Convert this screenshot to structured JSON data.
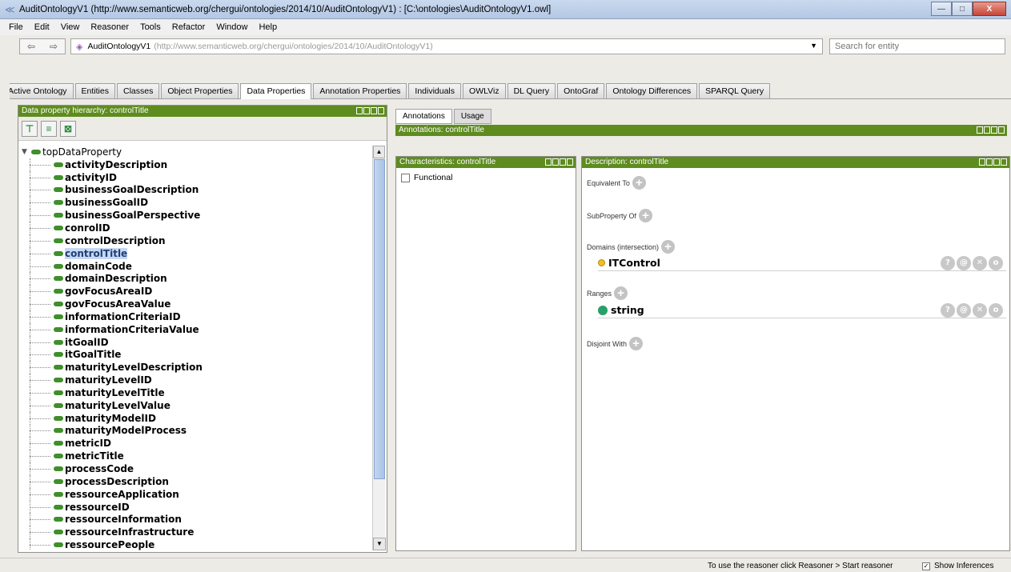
{
  "window": {
    "title": "AuditOntologyV1 (http://www.semanticweb.org/chergui/ontologies/2014/10/AuditOntologyV1)  : [C:\\ontologies\\AuditOntologyV1.owl]",
    "minimize": "—",
    "maximize": "□",
    "close": "X"
  },
  "menu": [
    "File",
    "Edit",
    "View",
    "Reasoner",
    "Tools",
    "Refactor",
    "Window",
    "Help"
  ],
  "address": {
    "name": "AuditOntologyV1",
    "uri": "(http://www.semanticweb.org/chergui/ontologies/2014/10/AuditOntologyV1)",
    "search_placeholder": "Search for entity"
  },
  "tabs": [
    {
      "label": "Active Ontology",
      "active": false
    },
    {
      "label": "Entities",
      "active": false
    },
    {
      "label": "Classes",
      "active": false
    },
    {
      "label": "Object Properties",
      "active": false
    },
    {
      "label": "Data Properties",
      "active": true
    },
    {
      "label": "Annotation Properties",
      "active": false
    },
    {
      "label": "Individuals",
      "active": false
    },
    {
      "label": "OWLViz",
      "active": false
    },
    {
      "label": "DL Query",
      "active": false
    },
    {
      "label": "OntoGraf",
      "active": false
    },
    {
      "label": "Ontology Differences",
      "active": false
    },
    {
      "label": "SPARQL Query",
      "active": false
    }
  ],
  "hierarchy": {
    "header": "Data property hierarchy: controlTitle",
    "root": "topDataProperty",
    "selected": "controlTitle",
    "items": [
      "activityDescription",
      "activityID",
      "businessGoalDescription",
      "businessGoalID",
      "businessGoalPerspective",
      "conrolID",
      "controlDescription",
      "controlTitle",
      "domainCode",
      "domainDescription",
      "govFocusAreaID",
      "govFocusAreaValue",
      "informationCriteriaID",
      "informationCriteriaValue",
      "itGoalID",
      "itGoalTitle",
      "maturityLevelDescription",
      "maturityLevelID",
      "maturityLevelTitle",
      "maturityLevelValue",
      "maturityModelID",
      "maturityModelProcess",
      "metricID",
      "metricTitle",
      "processCode",
      "processDescription",
      "ressourceApplication",
      "ressourceID",
      "ressourceInformation",
      "ressourceInfrastructure",
      "ressourcePeople"
    ]
  },
  "subtabs": {
    "annotations": "Annotations",
    "usage": "Usage"
  },
  "annotations_header": "Annotations: controlTitle",
  "characteristics": {
    "header": "Characteristics: controlTitle",
    "functional": "Functional"
  },
  "description": {
    "header": "Description: controlTitle",
    "equivalent_to": "Equivalent To",
    "subproperty_of": "SubProperty Of",
    "domains": "Domains (intersection)",
    "domain_value": "ITControl",
    "ranges": "Ranges",
    "range_value": "string",
    "disjoint_with": "Disjoint With"
  },
  "status": {
    "text": "To use the reasoner click Reasoner > Start reasoner",
    "show_inferences": "Show Inferences"
  }
}
